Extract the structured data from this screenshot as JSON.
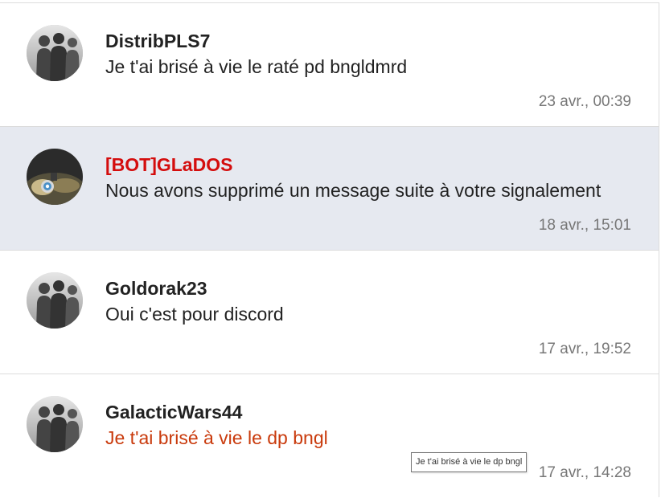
{
  "conversations": [
    {
      "avatar_icon": "people-silhouette-avatar-icon",
      "author": "DistribPLS7",
      "preview": "Je t'ai brisé à vie le raté pd bngldmrd",
      "date": "23 avr., 00:39"
    },
    {
      "avatar_icon": "bot-eye-avatar-icon",
      "author": "[BOT]GLaDOS",
      "preview": "Nous avons supprimé un message suite à votre signalement",
      "date": "18 avr., 15:01"
    },
    {
      "avatar_icon": "people-silhouette-avatar-icon",
      "author": "Goldorak23",
      "preview": "Oui c'est pour discord",
      "date": "17 avr., 19:52"
    },
    {
      "avatar_icon": "people-silhouette-avatar-icon",
      "author": "GalacticWars44",
      "preview": "Je t'ai brisé à vie le dp bngl",
      "date": "17 avr., 14:28"
    }
  ],
  "tooltip": {
    "text": "Je t'ai brisé à vie le dp bngl"
  },
  "colors": {
    "unread_background": "#e6e9f0",
    "bot_author": "#d40d0d",
    "alert_preview": "#c93a0c",
    "date_text": "#777777"
  }
}
